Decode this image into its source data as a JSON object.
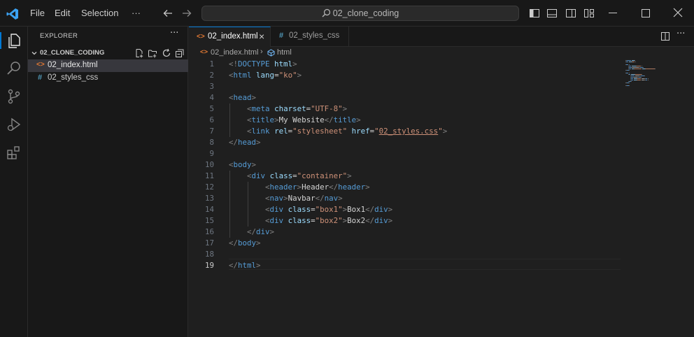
{
  "titlebar": {
    "menus": [
      "File",
      "Edit",
      "Selection"
    ],
    "more": "···",
    "search_text": "02_clone_coding"
  },
  "sidebar": {
    "title": "EXPLORER",
    "more": "···",
    "folder": "02_CLONE_CODING",
    "files": [
      {
        "name": "02_index.html",
        "icon": "html-file-icon",
        "selected": true
      },
      {
        "name": "02_styles_css",
        "icon": "hash-file-icon",
        "selected": false
      }
    ]
  },
  "tabs": [
    {
      "label": "02_index.html",
      "active": true,
      "close": "×"
    },
    {
      "label": "02_styles_css",
      "active": false
    }
  ],
  "breadcrumb": {
    "file": "02_index.html",
    "separator": "›",
    "symbol": "html"
  },
  "editor": {
    "current_line": 19,
    "line_numbers": [
      "1",
      "2",
      "3",
      "4",
      "5",
      "6",
      "7",
      "8",
      "9",
      "10",
      "11",
      "12",
      "13",
      "14",
      "15",
      "16",
      "17",
      "18",
      "19"
    ],
    "lines": [
      [
        [
          "t",
          "<!"
        ],
        [
          "n",
          "DOCTYPE"
        ],
        [
          "x",
          " "
        ],
        [
          "a",
          "html"
        ],
        [
          "t",
          ">"
        ]
      ],
      [
        [
          "t",
          "<"
        ],
        [
          "n",
          "html"
        ],
        [
          "x",
          " "
        ],
        [
          "a",
          "lang"
        ],
        [
          "x",
          "="
        ],
        [
          "s",
          "\"ko\""
        ],
        [
          "t",
          ">"
        ]
      ],
      [],
      [
        [
          "t",
          "<"
        ],
        [
          "n",
          "head"
        ],
        [
          "t",
          ">"
        ]
      ],
      [
        [
          "x",
          "    "
        ],
        [
          "t",
          "<"
        ],
        [
          "n",
          "meta"
        ],
        [
          "x",
          " "
        ],
        [
          "a",
          "charset"
        ],
        [
          "x",
          "="
        ],
        [
          "s",
          "\"UTF-8\""
        ],
        [
          "t",
          ">"
        ]
      ],
      [
        [
          "x",
          "    "
        ],
        [
          "t",
          "<"
        ],
        [
          "n",
          "title"
        ],
        [
          "t",
          ">"
        ],
        [
          "x",
          "My Website"
        ],
        [
          "t",
          "</"
        ],
        [
          "n",
          "title"
        ],
        [
          "t",
          ">"
        ]
      ],
      [
        [
          "x",
          "    "
        ],
        [
          "t",
          "<"
        ],
        [
          "n",
          "link"
        ],
        [
          "x",
          " "
        ],
        [
          "a",
          "rel"
        ],
        [
          "x",
          "="
        ],
        [
          "s",
          "\"stylesheet\""
        ],
        [
          "x",
          " "
        ],
        [
          "a",
          "href"
        ],
        [
          "x",
          "="
        ],
        [
          "s",
          "\""
        ],
        [
          "sl",
          "02_styles.css"
        ],
        [
          "s",
          "\""
        ],
        [
          "t",
          ">"
        ]
      ],
      [
        [
          "t",
          "</"
        ],
        [
          "n",
          "head"
        ],
        [
          "t",
          ">"
        ]
      ],
      [],
      [
        [
          "t",
          "<"
        ],
        [
          "n",
          "body"
        ],
        [
          "t",
          ">"
        ]
      ],
      [
        [
          "x",
          "    "
        ],
        [
          "t",
          "<"
        ],
        [
          "n",
          "div"
        ],
        [
          "x",
          " "
        ],
        [
          "a",
          "class"
        ],
        [
          "x",
          "="
        ],
        [
          "s",
          "\"container\""
        ],
        [
          "t",
          ">"
        ]
      ],
      [
        [
          "x",
          "        "
        ],
        [
          "t",
          "<"
        ],
        [
          "n",
          "header"
        ],
        [
          "t",
          ">"
        ],
        [
          "x",
          "Header"
        ],
        [
          "t",
          "</"
        ],
        [
          "n",
          "header"
        ],
        [
          "t",
          ">"
        ]
      ],
      [
        [
          "x",
          "        "
        ],
        [
          "t",
          "<"
        ],
        [
          "n",
          "nav"
        ],
        [
          "t",
          ">"
        ],
        [
          "x",
          "Navbar"
        ],
        [
          "t",
          "</"
        ],
        [
          "n",
          "nav"
        ],
        [
          "t",
          ">"
        ]
      ],
      [
        [
          "x",
          "        "
        ],
        [
          "t",
          "<"
        ],
        [
          "n",
          "div"
        ],
        [
          "x",
          " "
        ],
        [
          "a",
          "class"
        ],
        [
          "x",
          "="
        ],
        [
          "s",
          "\"box1\""
        ],
        [
          "t",
          ">"
        ],
        [
          "x",
          "Box1"
        ],
        [
          "t",
          "</"
        ],
        [
          "n",
          "div"
        ],
        [
          "t",
          ">"
        ]
      ],
      [
        [
          "x",
          "        "
        ],
        [
          "t",
          "<"
        ],
        [
          "n",
          "div"
        ],
        [
          "x",
          " "
        ],
        [
          "a",
          "class"
        ],
        [
          "x",
          "="
        ],
        [
          "s",
          "\"box2\""
        ],
        [
          "t",
          ">"
        ],
        [
          "x",
          "Box2"
        ],
        [
          "t",
          "</"
        ],
        [
          "n",
          "div"
        ],
        [
          "t",
          ">"
        ]
      ],
      [
        [
          "x",
          "    "
        ],
        [
          "t",
          "</"
        ],
        [
          "n",
          "div"
        ],
        [
          "t",
          ">"
        ]
      ],
      [
        [
          "t",
          "</"
        ],
        [
          "n",
          "body"
        ],
        [
          "t",
          ">"
        ]
      ],
      [],
      [
        [
          "t",
          "</"
        ],
        [
          "n",
          "html"
        ],
        [
          "t",
          ">"
        ]
      ]
    ]
  },
  "colors": {
    "accent": "#0078d4",
    "vscode_logo": "#3ba1f1",
    "html_icon": "#e37933",
    "css_icon": "#519aba"
  }
}
